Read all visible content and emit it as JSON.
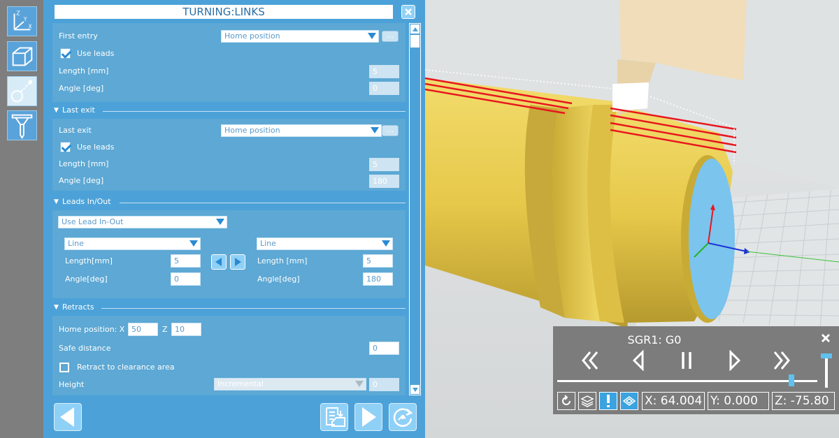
{
  "panel": {
    "title": "TURNING:LINKS",
    "first_entry": {
      "label": "First entry",
      "value": "Home position",
      "ellipsis": "...",
      "use_leads_label": "Use leads",
      "use_leads_checked": true,
      "length_label": "Length [mm]",
      "length_value": "5",
      "angle_label": "Angle [deg]",
      "angle_value": "0"
    },
    "last_exit": {
      "section_title": "Last exit",
      "label": "Last exit",
      "value": "Home position",
      "ellipsis": "...",
      "use_leads_label": "Use leads",
      "use_leads_checked": true,
      "length_label": "Length [mm]",
      "length_value": "5",
      "angle_label": "Angle [deg]",
      "angle_value": "180"
    },
    "leads": {
      "section_title": "Leads In/Out",
      "mode_value": "Use Lead In-Out",
      "left": {
        "type": "Line",
        "length_label": "Length[mm]",
        "length_value": "5",
        "angle_label": "Angle[deg]",
        "angle_value": "0"
      },
      "right": {
        "type": "Line",
        "length_label": "Length [mm]",
        "length_value": "5",
        "angle_label": "Angle[deg]",
        "angle_value": "180"
      }
    },
    "retracts": {
      "section_title": "Retracts",
      "home_label": "Home position: X",
      "home_x": "50",
      "z_label": "Z",
      "home_z": "10",
      "safe_label": "Safe distance",
      "safe_value": "0",
      "retract_label": "Retract to clearance area",
      "retract_checked": false,
      "height_label": "Height",
      "height_mode": "Incremental",
      "height_value": "0"
    }
  },
  "player": {
    "title": "SGR1: G0",
    "progress": 0.9,
    "speed": 0.95,
    "x": "X: 64.004",
    "y": "Y: 0.000",
    "z": "Z: -75.80"
  },
  "colors": {
    "panel_bg": "#4ca2d8",
    "section_bg": "#5da8d4",
    "toolbar_bg": "#7e7e7e",
    "player_bg": "#7c7c7c",
    "accent": "#5fc1ef",
    "part": "#e9cf52",
    "toolpath": "#e8161e"
  },
  "icons": {
    "toolbar": [
      "xyz-axes-icon",
      "stock-box-icon",
      "toolpath-icon",
      "cutting-tool-icon"
    ],
    "nav": [
      "back-arrow-icon",
      "save-export-icon",
      "forward-arrow-icon",
      "compute-icon"
    ],
    "player": [
      "fast-rewind-icon",
      "step-back-icon",
      "pause-icon",
      "step-forward-icon",
      "fast-forward-icon",
      "close-icon",
      "reset-view-icon",
      "layers-icon",
      "exclamation-icon",
      "stock-view-icon"
    ]
  }
}
